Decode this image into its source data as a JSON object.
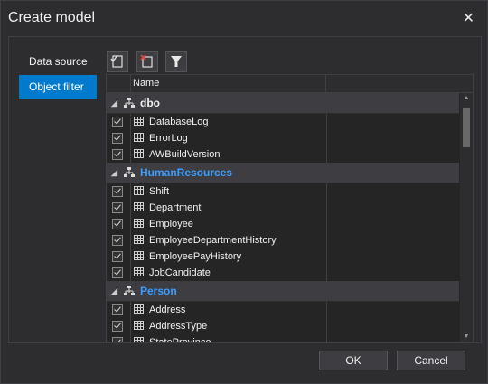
{
  "window": {
    "title": "Create model",
    "close_glyph": "✕"
  },
  "nav": {
    "items": [
      {
        "label": "Data source"
      },
      {
        "label": "Object filter"
      }
    ]
  },
  "toolbar": {
    "icons": [
      "check-all-icon",
      "uncheck-all-icon",
      "filter-icon"
    ]
  },
  "grid": {
    "header": "Name",
    "groups": [
      {
        "name": "dbo",
        "color": "#f1f1f1",
        "items": [
          "DatabaseLog",
          "ErrorLog",
          "AWBuildVersion"
        ]
      },
      {
        "name": "HumanResources",
        "color": "#3b9dff",
        "items": [
          "Shift",
          "Department",
          "Employee",
          "EmployeeDepartmentHistory",
          "EmployeePayHistory",
          "JobCandidate"
        ]
      },
      {
        "name": "Person",
        "color": "#3b9dff",
        "items": [
          "Address",
          "AddressType",
          "StateProvince"
        ]
      }
    ]
  },
  "buttons": {
    "ok": "OK",
    "cancel": "Cancel"
  },
  "colors": {
    "accent": "#007acc",
    "background": "#2d2d30"
  }
}
